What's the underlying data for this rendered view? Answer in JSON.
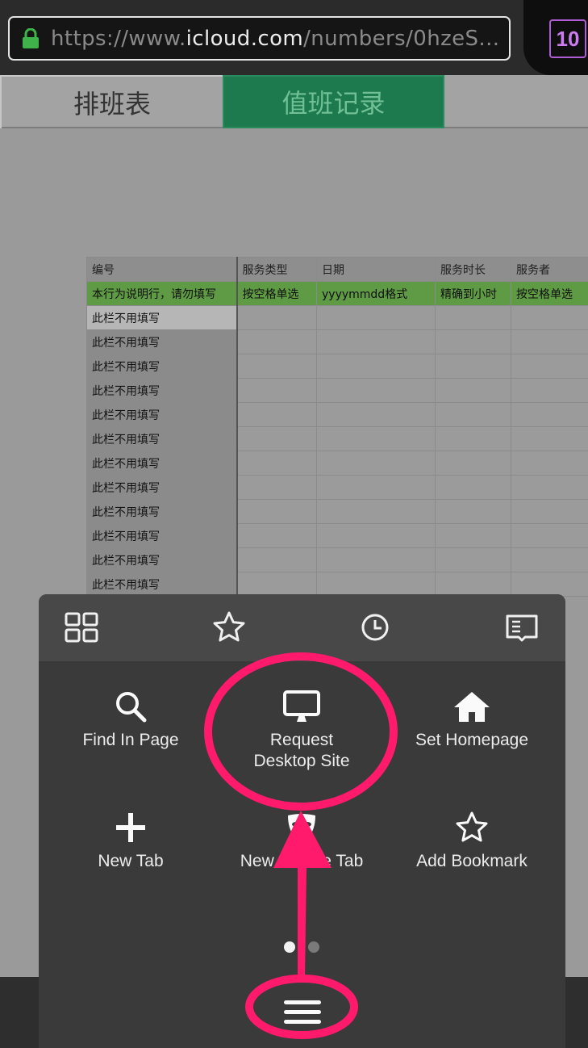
{
  "browser": {
    "url_prefix": "https://www.",
    "url_host": "icloud.com",
    "url_suffix": "/numbers/0hzeS...",
    "tab_count": "10",
    "lock_icon": "lock-icon",
    "colors": {
      "lock": "#3fb24a",
      "tab_count": "#cc7bf0"
    }
  },
  "sheet_tabs": [
    {
      "label": "排班表",
      "active": false
    },
    {
      "label": "值班记录",
      "active": true
    }
  ],
  "table": {
    "headers": [
      "编号",
      "服务类型",
      "日期",
      "服务时长",
      "服务者"
    ],
    "note_row": [
      "本行为说明行，请勿填写",
      "按空格单选",
      "yyyymmdd格式",
      "精确到小时",
      "按空格单选"
    ],
    "rows": [
      [
        "此栏不用填写",
        "",
        "",
        "",
        ""
      ],
      [
        "此栏不用填写",
        "",
        "",
        "",
        ""
      ],
      [
        "此栏不用填写",
        "",
        "",
        "",
        ""
      ],
      [
        "此栏不用填写",
        "",
        "",
        "",
        ""
      ],
      [
        "此栏不用填写",
        "",
        "",
        "",
        ""
      ],
      [
        "此栏不用填写",
        "",
        "",
        "",
        ""
      ],
      [
        "此栏不用填写",
        "",
        "",
        "",
        ""
      ],
      [
        "此栏不用填写",
        "",
        "",
        "",
        ""
      ],
      [
        "此栏不用填写",
        "",
        "",
        "",
        ""
      ],
      [
        "此栏不用填写",
        "",
        "",
        "",
        ""
      ],
      [
        "此栏不用填写",
        "",
        "",
        "",
        ""
      ],
      [
        "此栏不用填写",
        "",
        "",
        "",
        ""
      ]
    ]
  },
  "menu": {
    "top_icons": [
      "top-sites-icon",
      "bookmarks-icon",
      "history-icon",
      "reading-list-icon"
    ],
    "items": [
      {
        "label": "Find In Page",
        "icon": "search-icon"
      },
      {
        "label": "Request\nDesktop Site",
        "icon": "desktop-icon"
      },
      {
        "label": "Set Homepage",
        "icon": "home-icon"
      },
      {
        "label": "New Tab",
        "icon": "plus-icon"
      },
      {
        "label": "New Private Tab",
        "icon": "mask-icon"
      },
      {
        "label": "Add Bookmark",
        "icon": "star-icon"
      }
    ],
    "page_indicator": {
      "pages": 2,
      "current": 1
    },
    "menu_icon": "hamburger-icon"
  },
  "annotation": {
    "color": "#ff1a6b"
  }
}
